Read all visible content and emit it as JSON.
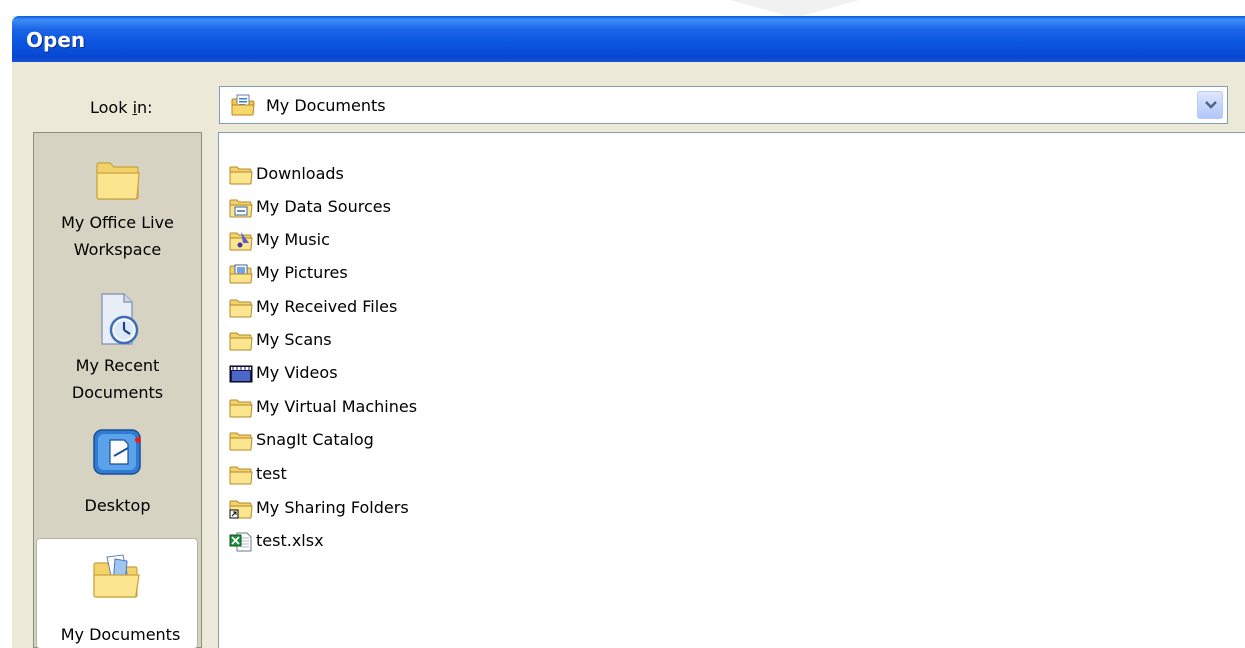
{
  "dialog": {
    "title": "Open"
  },
  "look_in": {
    "label_prefix": "Look ",
    "label_accel": "i",
    "label_suffix": "n:",
    "value": "My Documents",
    "icon": "my-documents-icon"
  },
  "places": [
    {
      "line1": "My Office Live",
      "line2": "Workspace",
      "icon": "folder-icon",
      "selected": false
    },
    {
      "line1": "My Recent",
      "line2": "Documents",
      "icon": "recent-documents-icon",
      "selected": false
    },
    {
      "line1": "Desktop",
      "line2": "",
      "icon": "desktop-icon",
      "selected": false
    },
    {
      "line1": "My Documents",
      "line2": "",
      "icon": "my-documents-icon",
      "selected": true
    }
  ],
  "files": [
    {
      "name": "Downloads",
      "icon": "folder-icon"
    },
    {
      "name": "My Data Sources",
      "icon": "data-sources-folder-icon"
    },
    {
      "name": "My Music",
      "icon": "music-folder-icon"
    },
    {
      "name": "My Pictures",
      "icon": "pictures-folder-icon"
    },
    {
      "name": "My Received Files",
      "icon": "folder-icon"
    },
    {
      "name": "My Scans",
      "icon": "folder-icon"
    },
    {
      "name": "My Videos",
      "icon": "videos-folder-icon"
    },
    {
      "name": "My Virtual Machines",
      "icon": "folder-icon"
    },
    {
      "name": "SnagIt Catalog",
      "icon": "folder-icon"
    },
    {
      "name": "test",
      "icon": "folder-icon"
    },
    {
      "name": "My Sharing Folders",
      "icon": "shortcut-folder-icon"
    },
    {
      "name": "test.xlsx",
      "icon": "excel-file-icon"
    }
  ],
  "colors": {
    "titlebar": "#0a55df",
    "dialog_bg": "#ece9d8",
    "folder_yellow": "#f7d774"
  }
}
